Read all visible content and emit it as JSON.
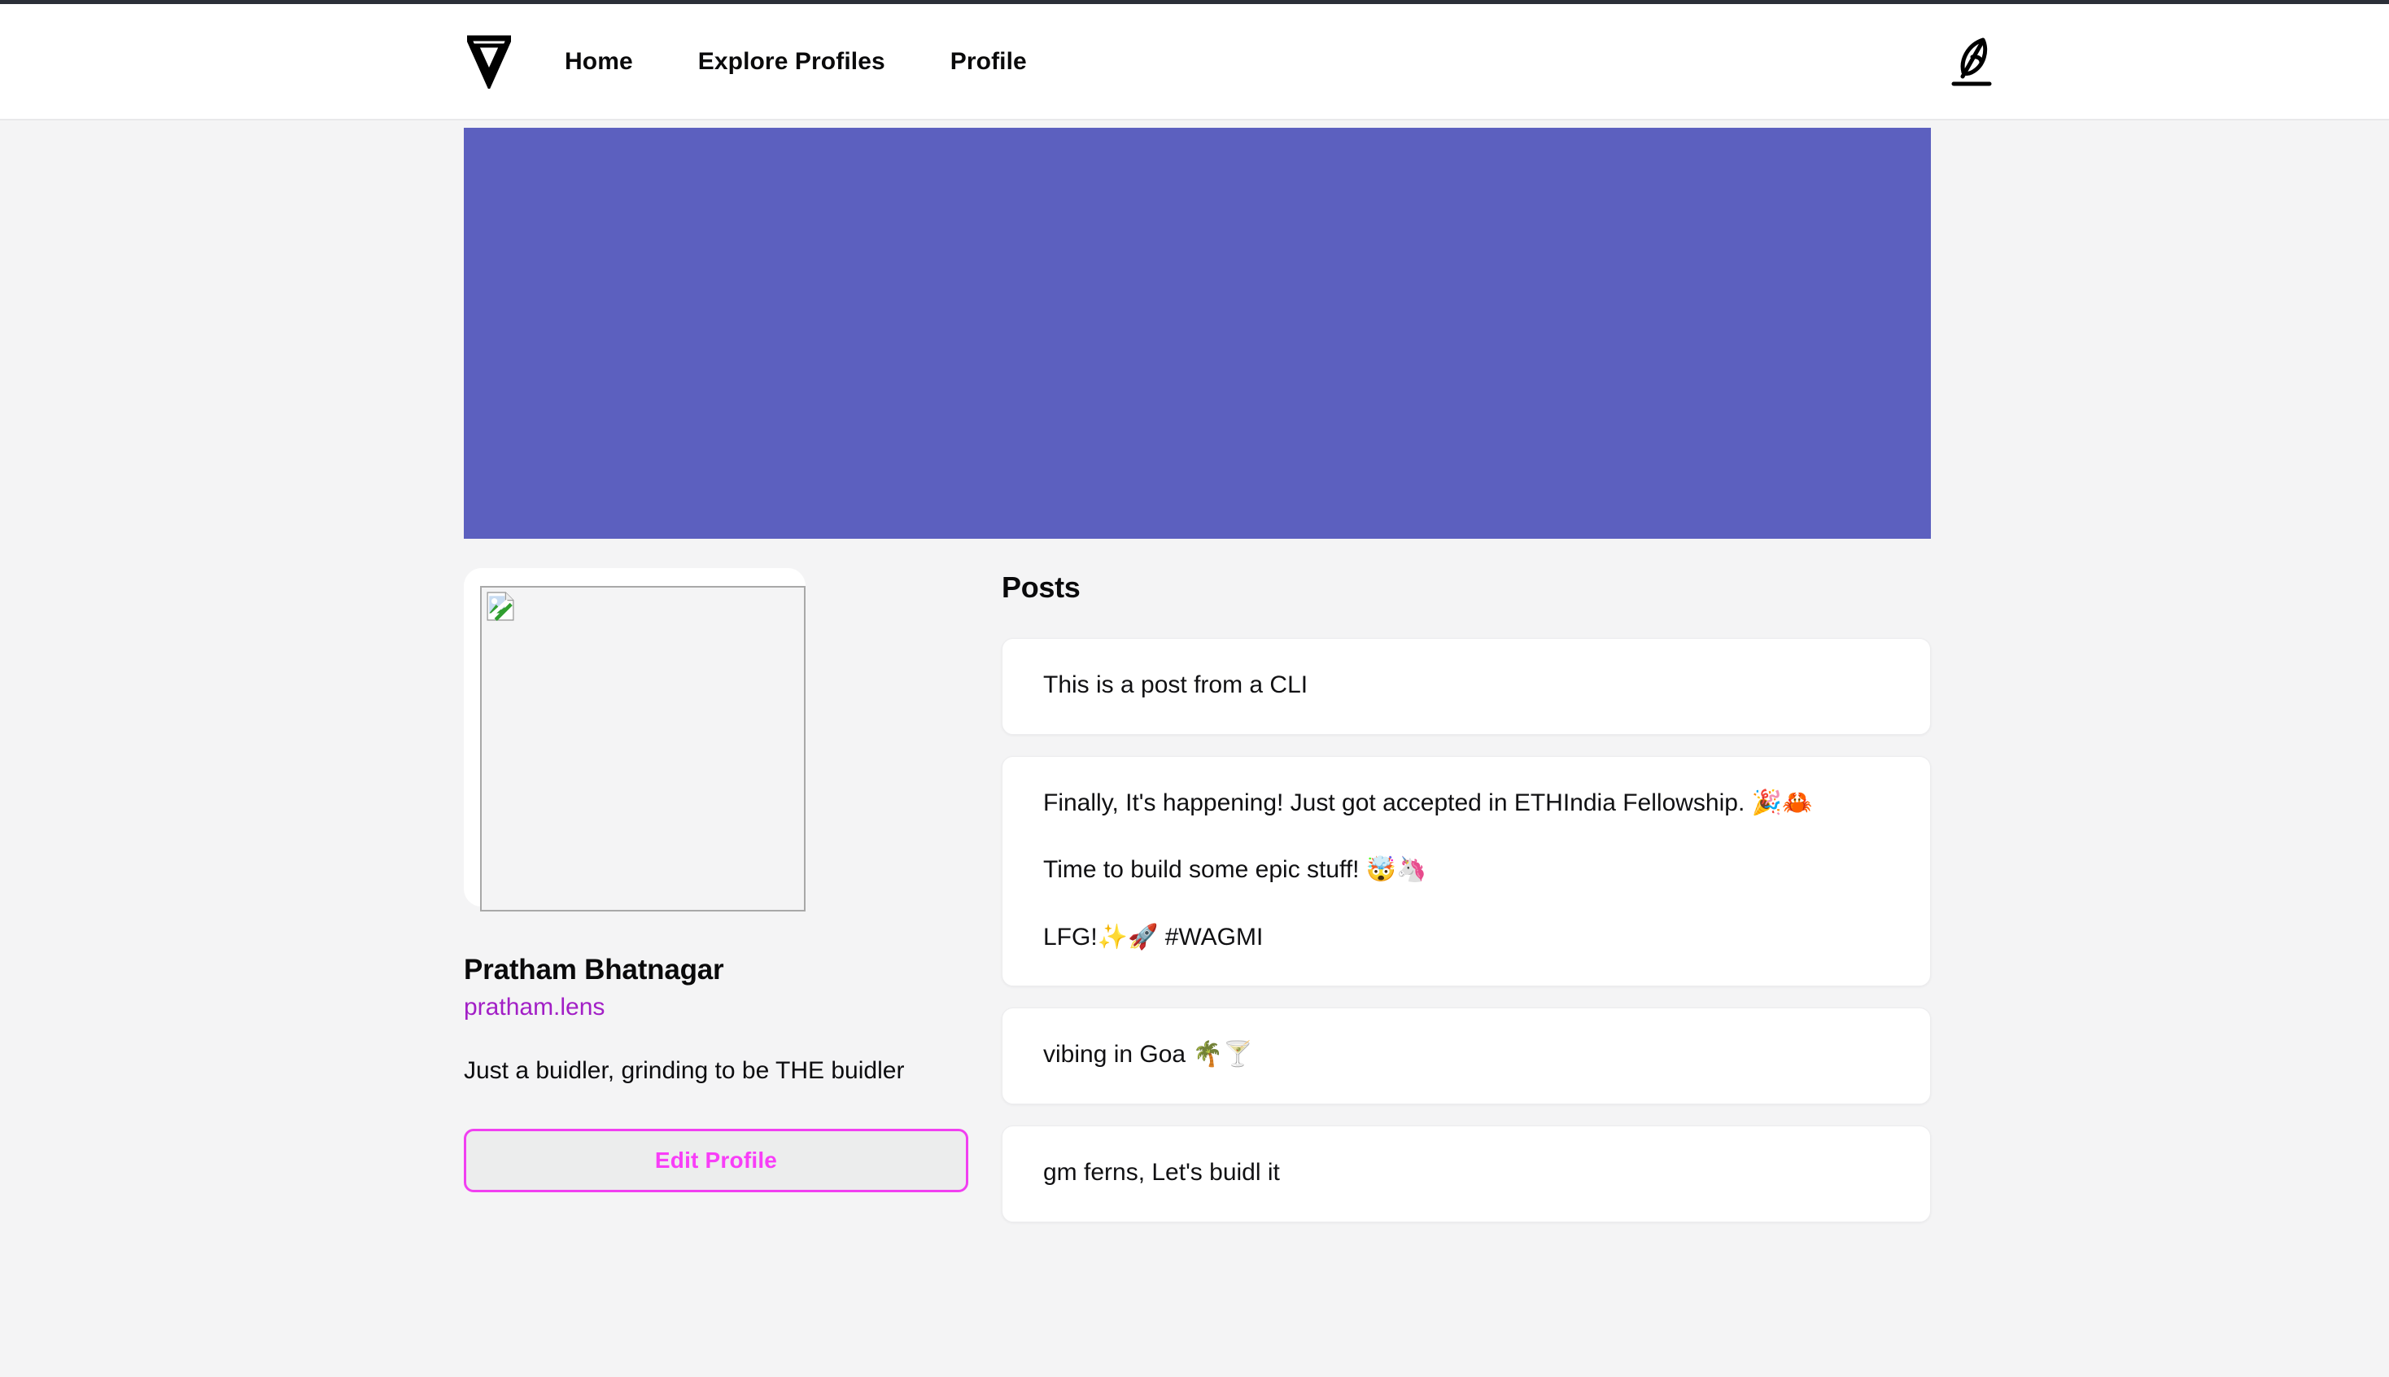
{
  "navbar": {
    "logo_icon": "lens-triangle-logo-icon",
    "links": [
      {
        "label": "Home"
      },
      {
        "label": "Explore Profiles"
      },
      {
        "label": "Profile"
      }
    ],
    "compose_icon": "feather-quill-icon"
  },
  "banner": {
    "color": "#5c60bf"
  },
  "profile": {
    "avatar_alt": "",
    "avatar_state": "broken-image",
    "name": "Pratham Bhatnagar",
    "handle": "pratham.lens",
    "handle_color": "#a21fc6",
    "bio": "Just a buidler, grinding to be THE buidler",
    "edit_button_label": "Edit Profile",
    "edit_button_color": "#f83ef8"
  },
  "posts_section": {
    "title": "Posts",
    "posts": [
      {
        "lines": [
          "This is a post from a CLI"
        ]
      },
      {
        "lines": [
          "Finally, It's happening! Just got accepted in ETHIndia Fellowship. 🎉🦀",
          "Time to build some epic stuff! 🤯🦄",
          "LFG!✨🚀 #WAGMI"
        ]
      },
      {
        "lines": [
          "vibing in Goa 🌴🍸"
        ]
      },
      {
        "lines": [
          "gm ferns, Let's buidl it"
        ]
      }
    ]
  }
}
